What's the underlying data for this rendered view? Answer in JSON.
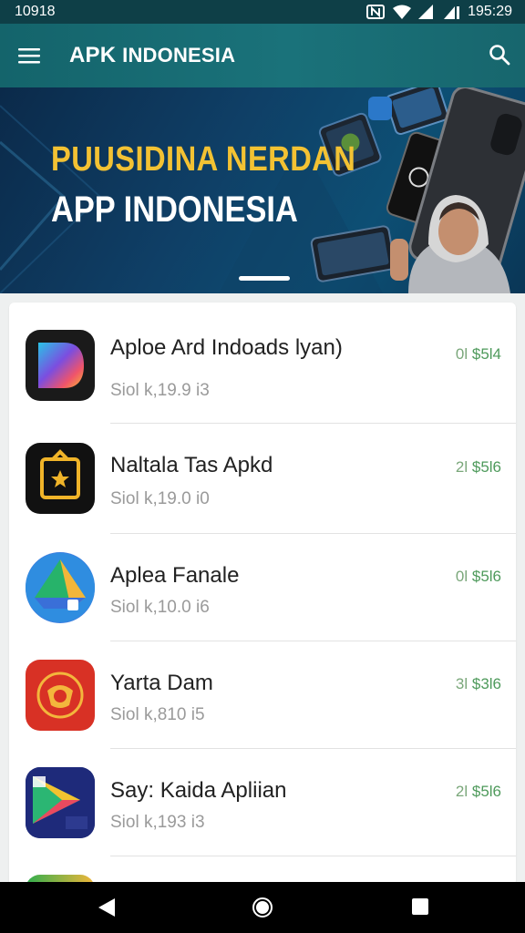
{
  "status_bar": {
    "time": "10918",
    "clock": "195:29"
  },
  "app_bar": {
    "title_main": "APK",
    "title_rest": "INDONESIA"
  },
  "banner": {
    "line1": "PUUSIDINA NERDAN",
    "line2": "APP INDONESIA"
  },
  "apps": [
    {
      "name": "Aploe Ard Indoads lyan)",
      "meta": "Siol k,19.9 i3",
      "price_prefix": "0l",
      "price": "$5l4"
    },
    {
      "name": "Naltala Tas Apkd",
      "meta": "Siol k,19.0 i0",
      "price_prefix": "2l",
      "price": "$5l6"
    },
    {
      "name": "Aplea Fanale",
      "meta": "Siol k,10.0 i6",
      "price_prefix": "0l",
      "price": "$5l6"
    },
    {
      "name": "Yarta Dam",
      "meta": "Siol k,810 i5",
      "price_prefix": "3l",
      "price": "$3l6"
    },
    {
      "name": "Say: Kaida Apliian",
      "meta": "Siol k,193 i3",
      "price_prefix": "2l",
      "price": "$5l6"
    }
  ]
}
